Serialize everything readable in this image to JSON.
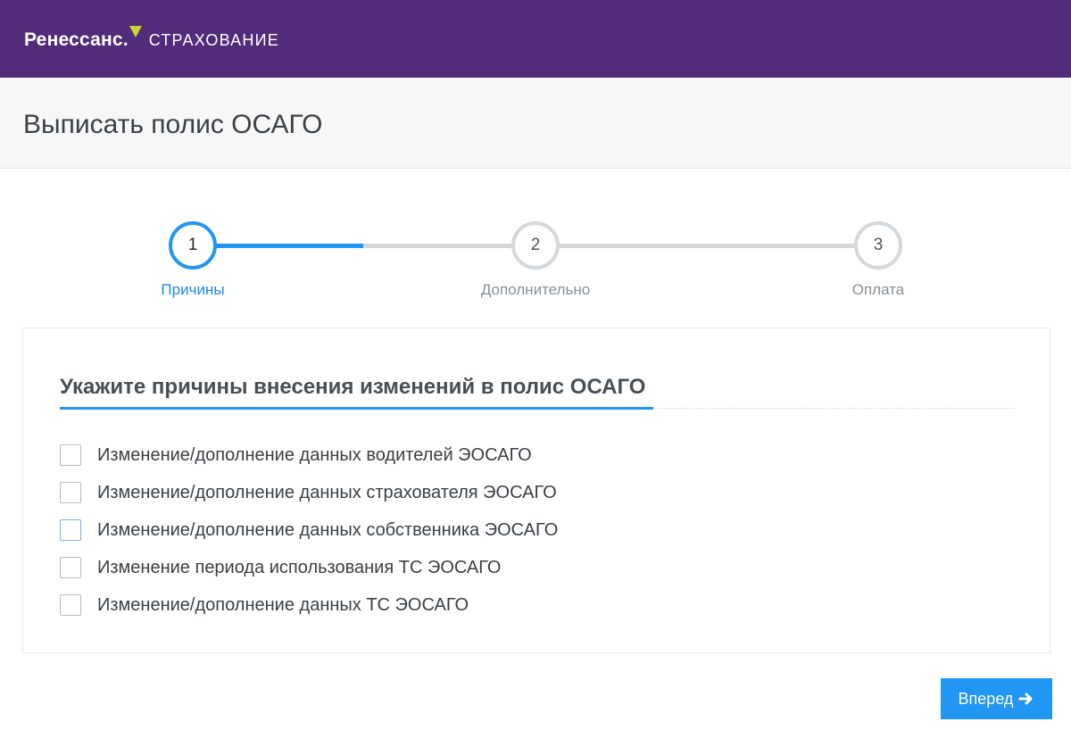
{
  "header": {
    "brand": "Ренессанс.",
    "brand_sub": "СТРАХОВАНИЕ",
    "brand_color": "#512c7a",
    "accent_mark_color": "#c8d62f"
  },
  "page": {
    "title": "Выписать полис ОСАГО"
  },
  "stepper": {
    "active_color": "#2196f3",
    "steps": [
      {
        "number": "1",
        "label": "Причины",
        "state": "active"
      },
      {
        "number": "2",
        "label": "Дополнительно",
        "state": "pending"
      },
      {
        "number": "3",
        "label": "Оплата",
        "state": "pending"
      }
    ]
  },
  "reasons": {
    "title": "Укажите причины внесения изменений в полис ОСАГО",
    "options": [
      {
        "label": "Изменение/дополнение данных водителей ЭОСАГО",
        "checked": false
      },
      {
        "label": "Изменение/дополнение данных страхователя ЭОСАГО",
        "checked": false
      },
      {
        "label": "Изменение/дополнение данных собственника ЭОСАГО",
        "checked": false
      },
      {
        "label": "Изменение периода использования ТС ЭОСАГО",
        "checked": false
      },
      {
        "label": "Изменение/дополнение данных ТС ЭОСАГО",
        "checked": false
      }
    ]
  },
  "actions": {
    "next_label": "Вперед",
    "next_icon": "arrow-right-icon"
  }
}
